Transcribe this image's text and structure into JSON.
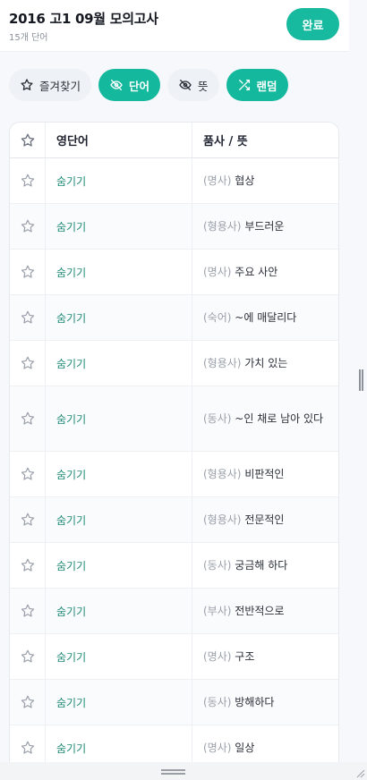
{
  "header": {
    "title": "2016 고1 09월 모의고사",
    "subtitle": "15개 단어",
    "done_label": "완료"
  },
  "filters": [
    {
      "label": "즐겨찾기",
      "icon": "star-outline-icon",
      "active": false
    },
    {
      "label": "단어",
      "icon": "eye-off-icon",
      "active": true
    },
    {
      "label": "뜻",
      "icon": "eye-off-icon",
      "active": false
    },
    {
      "label": "랜덤",
      "icon": "shuffle-icon",
      "active": true
    }
  ],
  "table": {
    "col_word": "영단어",
    "col_meaning": "품사 / 뜻",
    "rows": [
      {
        "word": "숨기기",
        "pos": "(명사)",
        "meaning": "협상"
      },
      {
        "word": "숨기기",
        "pos": "(형용사)",
        "meaning": "부드러운"
      },
      {
        "word": "숨기기",
        "pos": "(명사)",
        "meaning": "주요 사안"
      },
      {
        "word": "숨기기",
        "pos": "(숙어)",
        "meaning": "~에 매달리다"
      },
      {
        "word": "숨기기",
        "pos": "(형용사)",
        "meaning": "가치 있는"
      },
      {
        "word": "숨기기",
        "pos": "(동사)",
        "meaning": "~인 채로 남아 있다"
      },
      {
        "word": "숨기기",
        "pos": "(형용사)",
        "meaning": "비판적인"
      },
      {
        "word": "숨기기",
        "pos": "(형용사)",
        "meaning": "전문적인"
      },
      {
        "word": "숨기기",
        "pos": "(동사)",
        "meaning": "궁금해 하다"
      },
      {
        "word": "숨기기",
        "pos": "(부사)",
        "meaning": "전반적으로"
      },
      {
        "word": "숨기기",
        "pos": "(명사)",
        "meaning": "구조"
      },
      {
        "word": "숨기기",
        "pos": "(동사)",
        "meaning": "방해하다"
      },
      {
        "word": "숨기기",
        "pos": "(명사)",
        "meaning": "일상"
      }
    ]
  },
  "colors": {
    "accent": "#17b99f",
    "word_text": "#1e8a76",
    "pos_text": "#9aa0aa"
  }
}
